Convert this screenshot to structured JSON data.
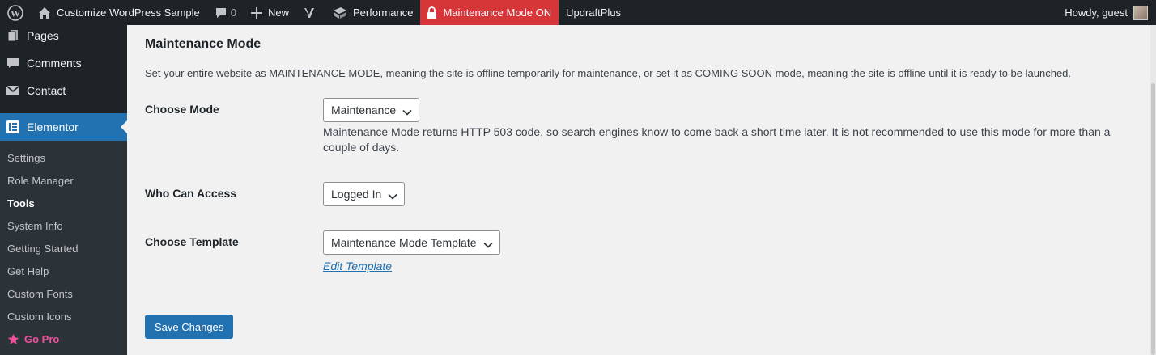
{
  "adminbar": {
    "site_name": "Customize WordPress Sample",
    "comments_count": "0",
    "new_label": "New",
    "performance_label": "Performance",
    "maintenance_label": "Maintenance Mode ON",
    "updraft_label": "UpdraftPlus",
    "howdy_label": "Howdy, guest",
    "icons": [
      "wordpress-icon",
      "home-icon",
      "comment-icon",
      "plus-icon",
      "yoast-icon",
      "performance-icon",
      "lock-icon"
    ],
    "maintenance_color": "#d63638"
  },
  "sidebar": {
    "top_items": [
      {
        "label": "Pages",
        "icon": "pages-icon"
      },
      {
        "label": "Comments",
        "icon": "comments-icon"
      },
      {
        "label": "Contact",
        "icon": "mail-icon"
      }
    ],
    "active_item": {
      "label": "Elementor",
      "icon": "elementor-icon",
      "color": "#2271b1"
    },
    "submenu": [
      {
        "label": "Settings"
      },
      {
        "label": "Role Manager"
      },
      {
        "label": "Tools"
      },
      {
        "label": "System Info"
      },
      {
        "label": "Getting Started"
      },
      {
        "label": "Get Help"
      },
      {
        "label": "Custom Fonts"
      },
      {
        "label": "Custom Icons"
      },
      {
        "label": "Go Pro",
        "icon": "star-icon"
      }
    ]
  },
  "main": {
    "title": "Maintenance Mode",
    "description": "Set your entire website as MAINTENANCE MODE, meaning the site is offline temporarily for maintenance, or set it as COMING SOON mode, meaning the site is offline until it is ready to be launched.",
    "choose_mode": {
      "label": "Choose Mode",
      "value": "Maintenance",
      "help": "Maintenance Mode returns HTTP 503 code, so search engines know to come back a short time later. It is not recommended to use this mode for more than a couple of days."
    },
    "who_can_access": {
      "label": "Who Can Access",
      "value": "Logged In"
    },
    "choose_template": {
      "label": "Choose Template",
      "value": "Maintenance Mode Template",
      "edit_link": "Edit Template"
    },
    "save_label": "Save Changes"
  }
}
